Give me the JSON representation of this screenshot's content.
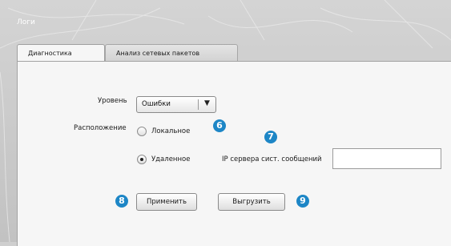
{
  "window": {
    "title": "Логи"
  },
  "tabs": [
    {
      "label": "Диагностика",
      "active": true
    },
    {
      "label": "Анализ сетевых пакетов",
      "active": false
    }
  ],
  "form": {
    "level": {
      "label": "Уровень",
      "selected": "Ошибки"
    },
    "location": {
      "label": "Расположение",
      "options": [
        {
          "label": "Локальное",
          "selected": false
        },
        {
          "label": "Удаленное",
          "selected": true
        }
      ]
    },
    "ip_field": {
      "label": "IP сервера сист. сообщений",
      "value": ""
    }
  },
  "buttons": {
    "apply": "Применить",
    "export": "Выгрузить"
  },
  "callouts": {
    "six": "6",
    "seven": "7",
    "eight": "8",
    "nine": "9"
  },
  "colors": {
    "callout": "#1d86c6",
    "panel": "#f6f6f6",
    "frame": "#c8c8c8"
  },
  "icons": {
    "select_arrow": "triangle-down"
  }
}
